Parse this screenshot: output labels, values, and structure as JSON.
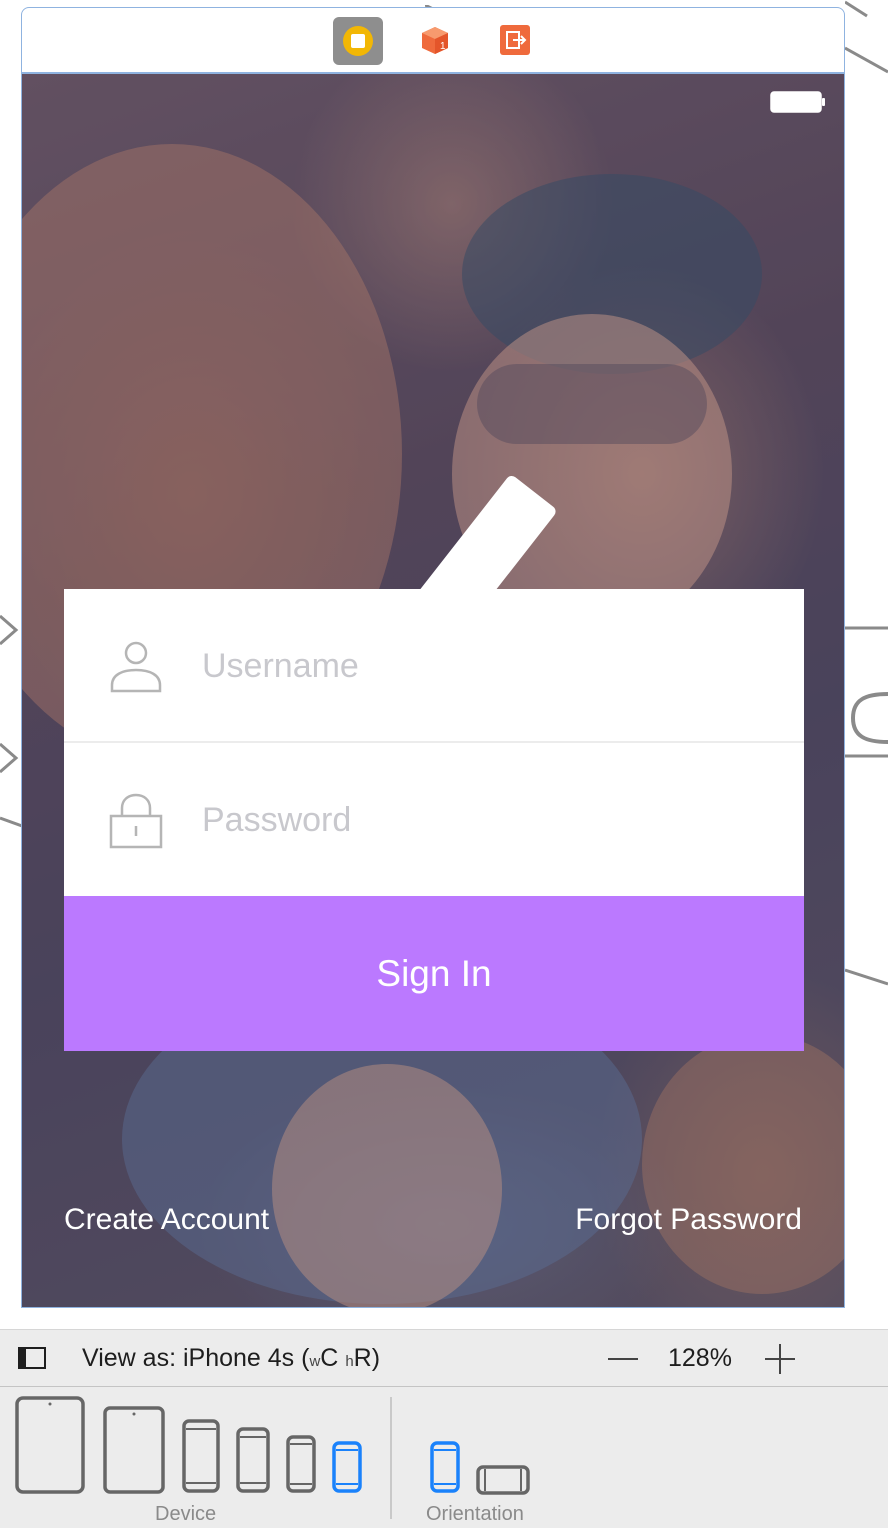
{
  "scene": {
    "dock_icons": [
      "view-controller-icon",
      "first-responder-icon",
      "exit-icon"
    ]
  },
  "login": {
    "username_placeholder": "Username",
    "password_placeholder": "Password",
    "signin_label": "Sign In",
    "create_account_label": "Create Account",
    "forgot_password_label": "Forgot Password",
    "accent_color": "#bb79ff"
  },
  "toolbar": {
    "view_as_prefix": "View as: iPhone 4s (",
    "size_class_w": "w",
    "size_class_w_value": "C",
    "size_class_h": "h",
    "size_class_h_value": "R",
    "view_as_suffix": ")",
    "zoom_level": "128%",
    "device_label": "Device",
    "orientation_label": "Orientation",
    "devices": [
      "iPad Pro 12.9",
      "iPad",
      "iPhone 6s Plus",
      "iPhone 6s",
      "iPhone 5s",
      "iPhone 4s"
    ],
    "selected_device": "iPhone 4s",
    "selected_orientation": "portrait",
    "selected_color": "#1a82fb"
  }
}
